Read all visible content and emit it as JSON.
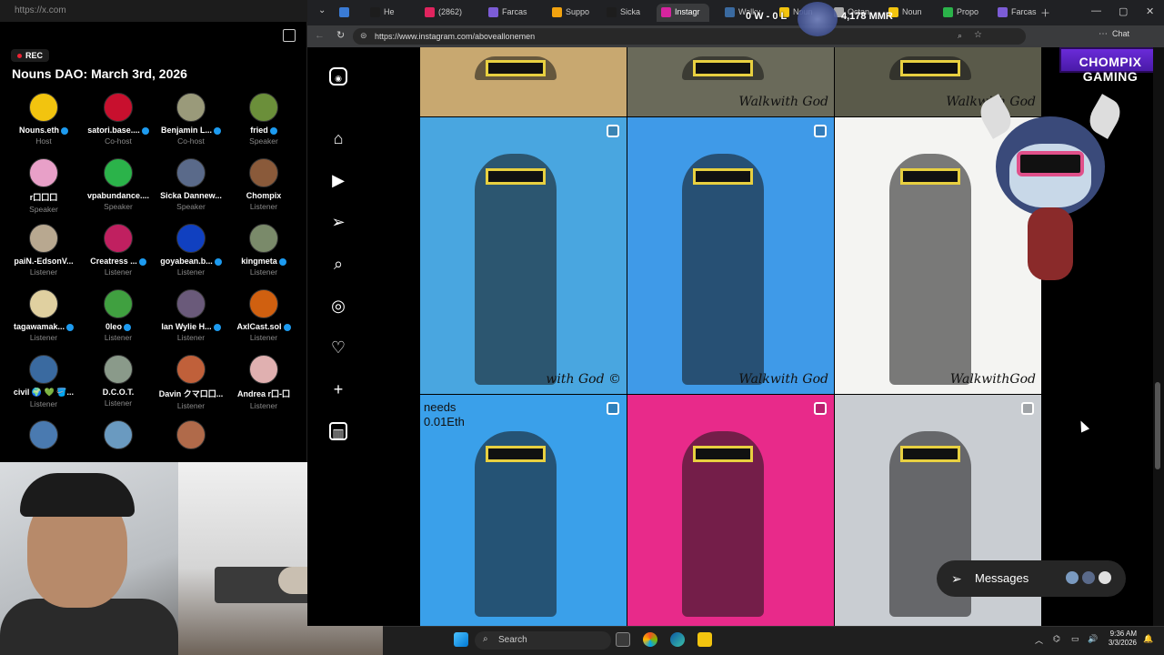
{
  "left_panel": {
    "url": "https://x.com",
    "rec_label": "REC",
    "space_title": "Nouns DAO: March 3rd, 2026",
    "participants": [
      {
        "name": "Nouns.eth",
        "role": "Host",
        "color": "#f2c40f",
        "verified": true
      },
      {
        "name": "satori.base....",
        "role": "Co-host",
        "color": "#c8102e",
        "verified": true
      },
      {
        "name": "Benjamin L...",
        "role": "Co-host",
        "color": "#9a9a7a",
        "verified": true
      },
      {
        "name": "fried",
        "role": "Speaker",
        "color": "#6b8f3a",
        "verified": true
      },
      {
        "name": "r囗囗囗",
        "role": "Speaker",
        "color": "#e8a0c8",
        "verified": false
      },
      {
        "name": "vpabundance....",
        "role": "Speaker",
        "color": "#2bb34a",
        "verified": false
      },
      {
        "name": "Sicka Dannew...",
        "role": "Speaker",
        "color": "#5a6a8a",
        "verified": false
      },
      {
        "name": "Chompix",
        "role": "Listener",
        "color": "#8a5a3a",
        "verified": false
      },
      {
        "name": "paiN.-EdsonV...",
        "role": "Listener",
        "color": "#b8a890",
        "verified": false
      },
      {
        "name": "Creatress ...",
        "role": "Listener",
        "color": "#c02060",
        "verified": true
      },
      {
        "name": "goyabean.b...",
        "role": "Listener",
        "color": "#1040c0",
        "verified": true
      },
      {
        "name": "kingmeta",
        "role": "Listener",
        "color": "#7a8a6a",
        "verified": true
      },
      {
        "name": "tagawamak...",
        "role": "Listener",
        "color": "#e0d0a0",
        "verified": true
      },
      {
        "name": "0leo",
        "role": "Listener",
        "color": "#40a040",
        "verified": true
      },
      {
        "name": "Ian Wylie H...",
        "role": "Listener",
        "color": "#6a5a7a",
        "verified": true
      },
      {
        "name": "AxlCast.sol",
        "role": "Listener",
        "color": "#d06010",
        "verified": true
      },
      {
        "name": "civil 🌍 💚 🪣...",
        "role": "Listener",
        "color": "#3a6aa0",
        "verified": false
      },
      {
        "name": "D.C.O.T.",
        "role": "Listener",
        "color": "#8a9a8a",
        "verified": false
      },
      {
        "name": "Davin クマ口囗...",
        "role": "Listener",
        "color": "#c0603a",
        "verified": false
      },
      {
        "name": "Andrea r囗-囗",
        "role": "Listener",
        "color": "#e0b0b0",
        "verified": false
      },
      {
        "name": "",
        "role": "",
        "color": "#4a7ab0",
        "verified": false
      },
      {
        "name": "",
        "role": "",
        "color": "#6a9ac0",
        "verified": false
      },
      {
        "name": "",
        "role": "",
        "color": "#b06a4a",
        "verified": false
      }
    ]
  },
  "browser": {
    "tabs": [
      {
        "label": "",
        "color": "#3a7bd5"
      },
      {
        "label": "He",
        "color": "#1d1d1d"
      },
      {
        "label": "(2862)",
        "color": "#e0245e"
      },
      {
        "label": "Farcas",
        "color": "#7c5cd6"
      },
      {
        "label": "Suppo",
        "color": "#f2a30f"
      },
      {
        "label": "Sicka",
        "color": "#1d1d1d"
      },
      {
        "label": "Instagr",
        "color": "#d6249f"
      },
      {
        "label": "Walkv",
        "color": "#3a6aa0"
      },
      {
        "label": "Noun",
        "color": "#f2c40f"
      },
      {
        "label": "Octan",
        "color": "#aaa"
      },
      {
        "label": "Noun",
        "color": "#f2c40f"
      },
      {
        "label": "Propo",
        "color": "#2bb34a"
      },
      {
        "label": "Farcas",
        "color": "#7c5cd6"
      }
    ],
    "active_tab_index": 6,
    "url": "https://www.instagram.com/aboveallonemen",
    "chat_label": "Chat"
  },
  "overlay": {
    "game_stats": "0 W - 0 L",
    "mmr": "4,178 MMR",
    "logo": "CHOMPIX GAMING"
  },
  "instagram": {
    "messages_label": "Messages",
    "posts": [
      {
        "bg": "#c8a870",
        "sig": ""
      },
      {
        "bg": "#6a6a5a",
        "sig": "Walkwith God"
      },
      {
        "bg": "#5a5a4a",
        "sig": "Walkwith God"
      },
      {
        "bg": "#49a6e0",
        "sig": "with God ©",
        "reel": true
      },
      {
        "bg": "#3f9ae8",
        "sig": "Walkwith God",
        "reel": true
      },
      {
        "bg": "#f4f4f2",
        "sig": "WalkwithGod"
      },
      {
        "bg": "#3aa0ea",
        "sig": "",
        "reel": true,
        "text": "needs\n0.01Eth"
      },
      {
        "bg": "#e82a8a",
        "sig": "",
        "reel": true
      },
      {
        "bg": "#c9cdd2",
        "sig": "",
        "reel": true
      }
    ]
  },
  "taskbar": {
    "search_placeholder": "Search",
    "time": "9:36 AM",
    "date": "3/3/2026"
  }
}
